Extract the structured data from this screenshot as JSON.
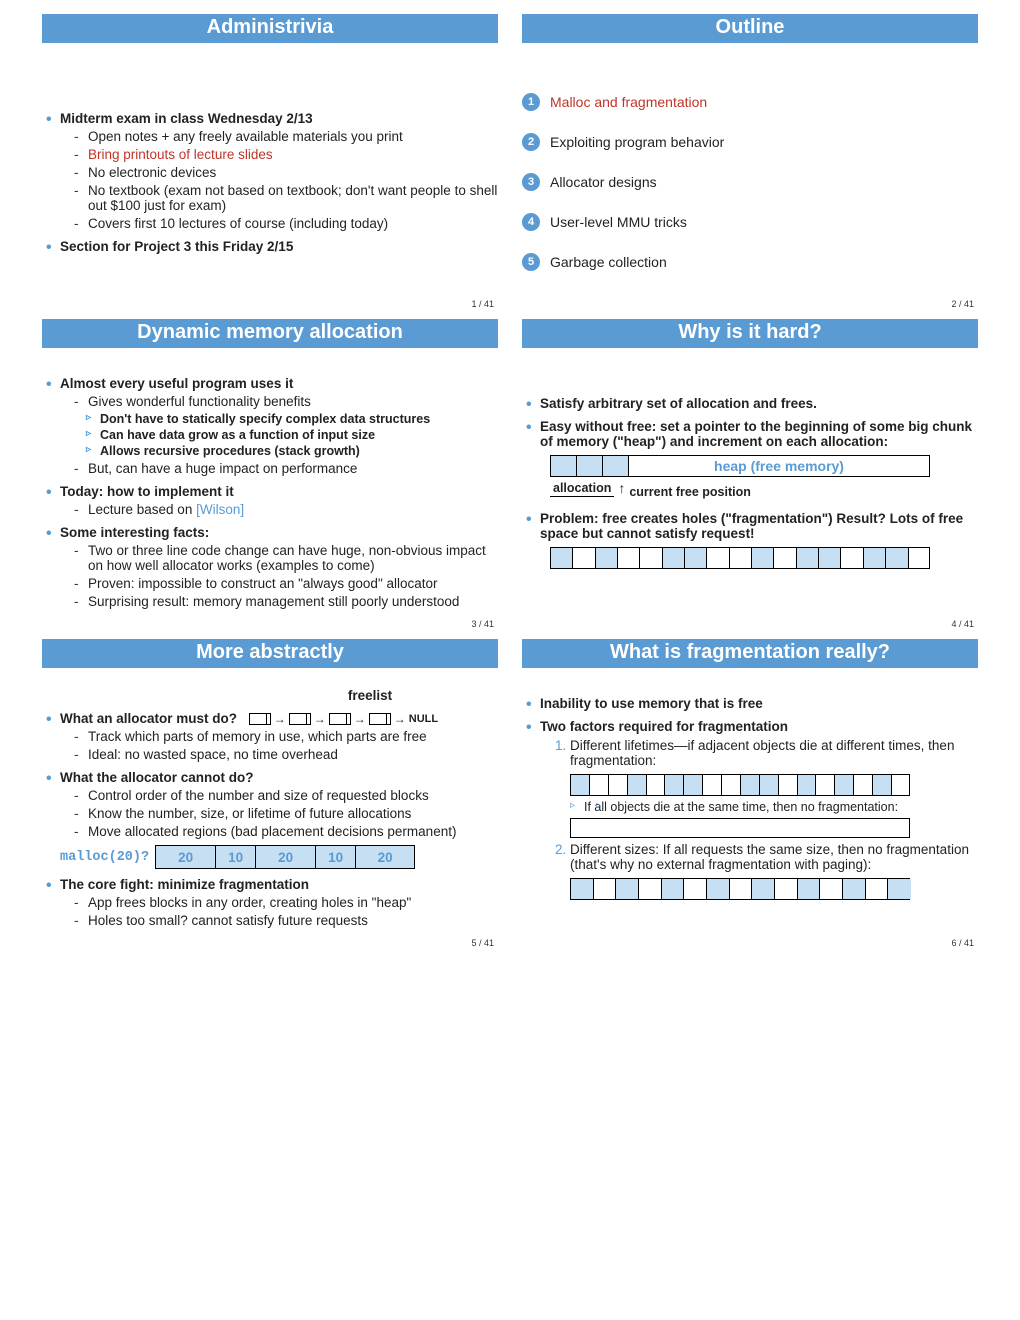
{
  "total_pages": "41",
  "slides": [
    {
      "title": "Administrivia",
      "page": "1 / 41",
      "bullets": {
        "b1": "Midterm exam in class Wednesday 2/13",
        "b1_subs": [
          "Open notes + any freely available materials you print",
          "Bring printouts of lecture slides",
          "No electronic devices",
          "No textbook (exam not based on textbook; don't want people to shell out $100 just for exam)",
          "Covers first 10 lectures of course (including today)"
        ],
        "b2": "Section for Project 3 this Friday 2/15"
      }
    },
    {
      "title": "Outline",
      "page": "2 / 41",
      "items": [
        "Malloc and fragmentation",
        "Exploiting program behavior",
        "Allocator designs",
        "User-level MMU tricks",
        "Garbage collection"
      ]
    },
    {
      "title": "Dynamic memory allocation",
      "page": "3 / 41",
      "b1": "Almost every useful program uses it",
      "b1_subs": [
        "Gives wonderful functionality benefits"
      ],
      "b1_subs2": [
        "Don't have to statically specify complex data structures",
        "Can have data grow as a function of input size",
        "Allows recursive procedures (stack growth)"
      ],
      "b1_subs_after": [
        "But, can have a huge impact on performance"
      ],
      "b2": "Today: how to implement it",
      "b2_subs_prefix": "Lecture based on ",
      "b2_link": "[Wilson]",
      "b3": "Some interesting facts:",
      "b3_subs": [
        "Two or three line code change can have huge, non-obvious impact on how well allocator works (examples to come)",
        "Proven: impossible to construct an \"always good\" allocator",
        "Surprising result: memory management still poorly understood"
      ]
    },
    {
      "title": "Why is it hard?",
      "page": "4 / 41",
      "b1": "Satisfy arbitrary set of allocation and frees.",
      "b2": "Easy without free: set a pointer to the beginning of some big chunk of memory (\"heap\") and increment on each allocation:",
      "heap_label": "heap (free memory)",
      "alloc_label": "allocation",
      "curpos_label": "current free position",
      "b3": "Problem: free creates holes (\"fragmentation\") Result? Lots of free space but cannot satisfy request!"
    },
    {
      "title": "More abstractly",
      "page": "5 / 41",
      "freelist_label": "freelist",
      "b1": "What an allocator must do?",
      "null_label": "NULL",
      "b1_subs": [
        "Track which parts of memory in use, which parts are free",
        "Ideal: no wasted space, no time overhead"
      ],
      "b2": "What the allocator cannot do?",
      "b2_subs": [
        "Control order of the number and size of requested blocks",
        "Know the number, size, or lifetime of future allocations",
        "Move allocated regions (bad placement decisions permanent)"
      ],
      "malloc_label": "malloc(20)?",
      "malloc_boxes": [
        "20",
        "10",
        "20",
        "10",
        "20"
      ],
      "b3": "The core fight: minimize fragmentation",
      "b3_subs": [
        "App frees blocks in any order, creating holes in \"heap\"",
        "Holes too small? cannot satisfy future requests"
      ]
    },
    {
      "title": "What is fragmentation really?",
      "page": "6 / 41",
      "b1": "Inability to use memory that is free",
      "b2": "Two factors required for fragmentation",
      "n1": "Different lifetimes—if adjacent objects die at different times, then fragmentation:",
      "note": "If all objects die at the same time, then no fragmentation:",
      "n2": "Different sizes: If all requests the same size, then no fragmentation (that's why no external fragmentation with paging):"
    }
  ],
  "chart_data": {
    "type": "table",
    "description": "Block diagrams illustrating heap memory segments (blue=allocated, white=free) used conceptually; no numeric axes.",
    "heap_easy": {
      "allocated_cells": 3,
      "free_region": "remaining heap"
    },
    "fragmented_segments_blue_white": [
      1,
      0,
      1,
      0,
      0,
      1,
      1,
      0,
      0,
      1,
      0,
      1,
      1,
      0,
      1,
      1,
      0
    ],
    "malloc_blocks": [
      20,
      10,
      20,
      10,
      20
    ],
    "frag_lifetimes": [
      1,
      0,
      0,
      1,
      0,
      1,
      1,
      0,
      0,
      1,
      1,
      0,
      1,
      0,
      1,
      0,
      1,
      0
    ],
    "frag_same_size": [
      1,
      0,
      1,
      0,
      1,
      0,
      1,
      0,
      1,
      0,
      1,
      0,
      1,
      0,
      1
    ]
  }
}
